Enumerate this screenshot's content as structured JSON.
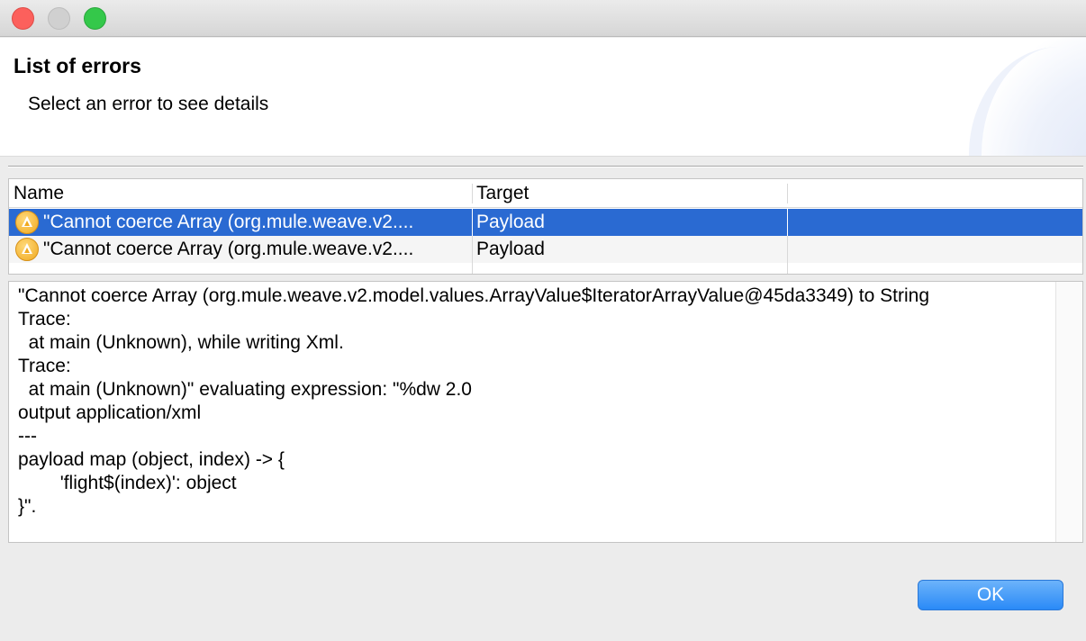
{
  "window": {
    "controls": [
      "close",
      "minimize",
      "maximize"
    ]
  },
  "header": {
    "title": "List of errors",
    "subtitle": "Select an error to see details"
  },
  "table": {
    "columns": [
      "Name",
      "Target"
    ],
    "rows": [
      {
        "name": "\"Cannot coerce Array (org.mule.weave.v2....",
        "target": "Payload",
        "icon": "warning-icon",
        "selected": true
      },
      {
        "name": "\"Cannot coerce Array (org.mule.weave.v2....",
        "target": "Payload",
        "icon": "warning-icon",
        "selected": false
      }
    ]
  },
  "details": {
    "text": "\"Cannot coerce Array (org.mule.weave.v2.model.values.ArrayValue$IteratorArrayValue@45da3349) to String\nTrace:\n  at main (Unknown), while writing Xml.\nTrace:\n  at main (Unknown)\" evaluating expression: \"%dw 2.0\noutput application/xml\n---\npayload map (object, index) -> {\n\t'flight$(index)': object\n}\"."
  },
  "footer": {
    "ok_label": "OK"
  },
  "colors": {
    "selection": "#2a6ad2",
    "ok_button": "#2a8af7",
    "warning": "#f0a91f"
  }
}
